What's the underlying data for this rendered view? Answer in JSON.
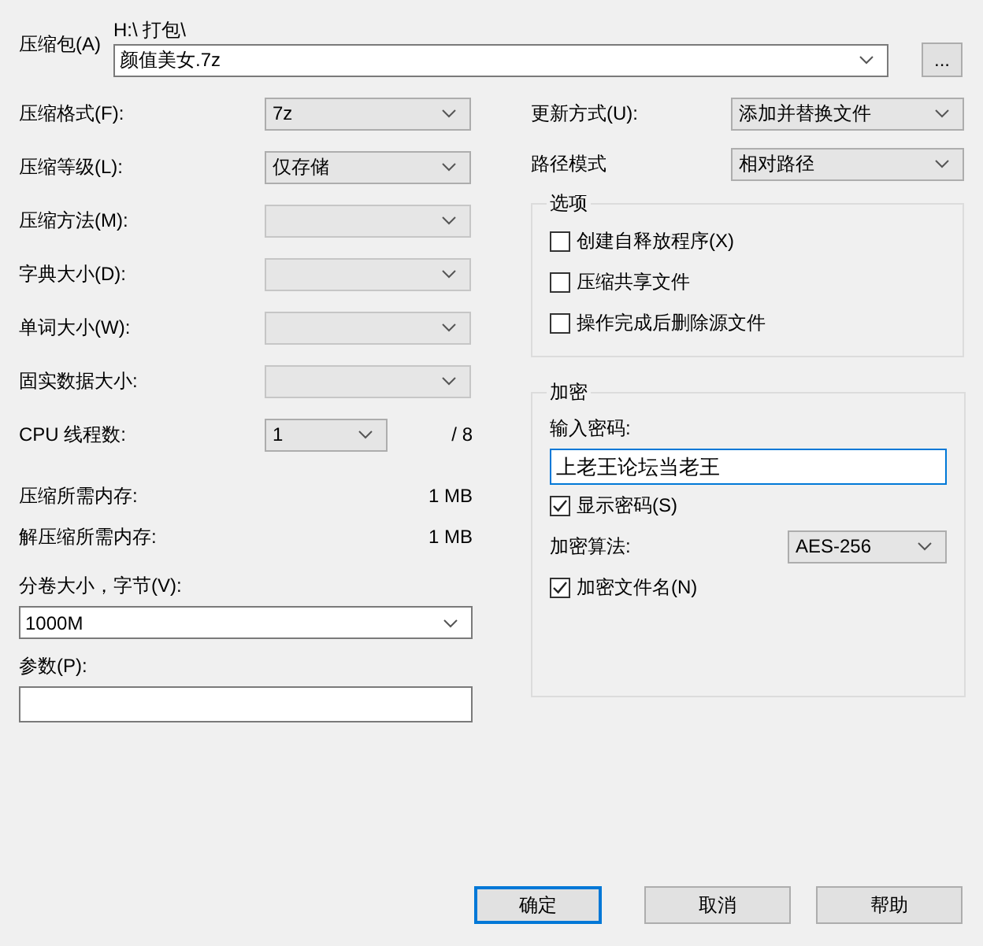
{
  "archive": {
    "label": "压缩包(A)",
    "path": "H:\\ 打包\\",
    "value": "颜值美女.7z",
    "browse": "..."
  },
  "left_fields": [
    {
      "kind": "combo",
      "label": "压缩格式(F):",
      "value": "7z",
      "disabled": false
    },
    {
      "kind": "combo",
      "label": "压缩等级(L):",
      "value": "仅存储",
      "disabled": false
    },
    {
      "kind": "combo",
      "label": "压缩方法(M):",
      "disabled": true
    },
    {
      "kind": "combo",
      "label": "字典大小(D):",
      "disabled": true
    },
    {
      "kind": "combo",
      "label": "单词大小(W):",
      "disabled": true
    },
    {
      "kind": "combo",
      "label": "固实数据大小:",
      "disabled": true
    },
    {
      "kind": "threads",
      "label": "CPU 线程数:",
      "value": "1",
      "total": "/ 8",
      "disabled": false
    }
  ],
  "memory": [
    {
      "label": "压缩所需内存:",
      "value": "1 MB"
    },
    {
      "label": "解压缩所需内存:",
      "value": "1 MB"
    }
  ],
  "split": {
    "label": "分卷大小，字节(V):",
    "value": "1000M"
  },
  "params": {
    "label": "参数(P):"
  },
  "right_fields": [
    {
      "label": "更新方式(U):",
      "value": "添加并替换文件"
    },
    {
      "label": "路径模式",
      "value": "相对路径"
    }
  ],
  "options": {
    "title": "选项",
    "items": [
      {
        "label": "创建自释放程序(X)",
        "checked": false
      },
      {
        "label": "压缩共享文件",
        "checked": false
      },
      {
        "label": "操作完成后删除源文件",
        "checked": false
      }
    ]
  },
  "encryption": {
    "title": "加密",
    "password_label": "输入密码:",
    "password": "上老王论坛当老王",
    "show_password": {
      "label": "显示密码(S)",
      "checked": true
    },
    "method_label": "加密算法:",
    "method": "AES-256",
    "encrypt_names": {
      "label": "加密文件名(N)",
      "checked": true
    }
  },
  "buttons": [
    {
      "label": "确定",
      "default": true
    },
    {
      "label": "取消",
      "default": false
    },
    {
      "label": "帮助",
      "default": false
    }
  ]
}
